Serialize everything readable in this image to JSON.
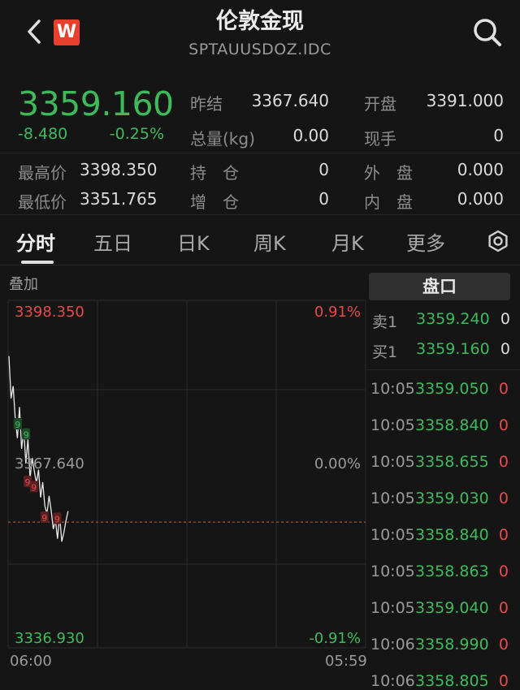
{
  "header": {
    "title": "伦敦金现",
    "subtitle": "SPTAUUSDOZ.IDC",
    "logo_letter": "W"
  },
  "quote": {
    "price": "3359.160",
    "change": "-8.480",
    "change_pct": "-0.25%",
    "stats": {
      "prev_settle_label": "昨结",
      "prev_settle": "3367.640",
      "open_label": "开盘",
      "open": "3391.000",
      "volume_label": "总量(kg)",
      "volume": "0.00",
      "current_hand_label": "现手",
      "current_hand": "0",
      "high_label": "最高价",
      "high": "3398.350",
      "hold_label": "持　仓",
      "hold": "0",
      "outer_label": "外　盘",
      "outer": "0.000",
      "low_label": "最低价",
      "low": "3351.765",
      "inc_label": "增　仓",
      "inc": "0",
      "inner_label": "内　盘",
      "inner": "0.000"
    }
  },
  "tabs": [
    "分时",
    "五日",
    "日K",
    "周K",
    "月K",
    "更多"
  ],
  "active_tab": "分时",
  "chart": {
    "overlay_label": "叠加",
    "top_price": "3398.350",
    "top_pct": "0.91%",
    "mid_price": "3367.640",
    "mid_pct": "0.00%",
    "bottom_price": "3336.930",
    "bottom_pct": "-0.91%",
    "time_start": "06:00",
    "time_end": "05:59",
    "marker_label": "9"
  },
  "chart_data": {
    "type": "line",
    "title": "",
    "ylim": [
      3336.93,
      3398.35
    ],
    "baseline": 3367.64,
    "current": 3359.16,
    "series": [
      {
        "values": [
          3388.5,
          3381.0,
          3383.2,
          3377.4,
          3374.0,
          3379.5,
          3372.1,
          3375.6,
          3369.5,
          3373.8,
          3366.9,
          3370.5,
          3368.2,
          3366.0,
          3368.4,
          3363.5,
          3366.2,
          3362.0,
          3360.6,
          3363.8,
          3361.2,
          3357.9,
          3359.6,
          3356.2,
          3360.4,
          3355.7,
          3357.3,
          3359.4,
          3361.1
        ]
      }
    ],
    "markers": [
      {
        "index": 3,
        "kind": "green"
      },
      {
        "index": 7,
        "kind": "green"
      },
      {
        "index": 10,
        "kind": "red"
      },
      {
        "index": 13,
        "kind": "red"
      },
      {
        "index": 18,
        "kind": "red"
      },
      {
        "index": 24,
        "kind": "red"
      }
    ],
    "colors": {
      "up": "#e64a4a",
      "down": "#3dbb5a",
      "line": "#e8e8e8",
      "baseline": "#c0683a"
    }
  },
  "order_book": {
    "button_label": "盘口",
    "ask1_label": "卖1",
    "ask1_price": "3359.240",
    "ask1_qty": "0",
    "bid1_label": "买1",
    "bid1_price": "3359.160",
    "bid1_qty": "0"
  },
  "trades": [
    {
      "time": "10:05",
      "price": "3359.050",
      "qty": "0"
    },
    {
      "time": "10:05",
      "price": "3358.840",
      "qty": "0"
    },
    {
      "time": "10:05",
      "price": "3358.655",
      "qty": "0"
    },
    {
      "time": "10:05",
      "price": "3359.030",
      "qty": "0"
    },
    {
      "time": "10:05",
      "price": "3358.840",
      "qty": "0"
    },
    {
      "time": "10:05",
      "price": "3358.863",
      "qty": "0"
    },
    {
      "time": "10:05",
      "price": "3359.040",
      "qty": "0"
    },
    {
      "time": "10:06",
      "price": "3358.990",
      "qty": "0"
    },
    {
      "time": "10:06",
      "price": "3358.805",
      "qty": "0"
    }
  ]
}
